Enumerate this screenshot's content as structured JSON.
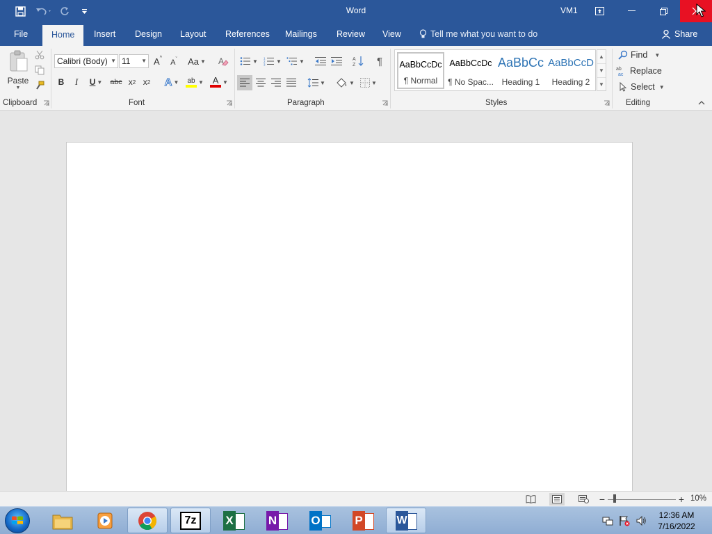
{
  "window": {
    "title": "Word",
    "user": "VM1"
  },
  "tabs": {
    "file": "File",
    "home": "Home",
    "insert": "Insert",
    "design": "Design",
    "layout": "Layout",
    "references": "References",
    "mailings": "Mailings",
    "review": "Review",
    "view": "View",
    "tell_me": "Tell me what you want to do",
    "share": "Share"
  },
  "ribbon": {
    "clipboard": {
      "paste_label": "Paste",
      "group_label": "Clipboard"
    },
    "font": {
      "font_name": "Calibri (Body)",
      "font_size": "11",
      "change_case": "Aa",
      "bold": "B",
      "italic": "I",
      "underline": "U",
      "strikethrough": "abc",
      "subscript": "x",
      "subscript_mark": "2",
      "superscript": "x",
      "superscript_mark": "2",
      "grow": "A",
      "shrink": "A",
      "text_effects": "A",
      "font_color": "A",
      "highlight": "ab",
      "group_label": "Font"
    },
    "paragraph": {
      "show_marks": "¶",
      "group_label": "Paragraph"
    },
    "styles": {
      "items": [
        {
          "sample": "AaBbCcDc",
          "name": "¶ Normal"
        },
        {
          "sample": "AaBbCcDc",
          "name": "¶ No Spac..."
        },
        {
          "sample": "AaBbCc",
          "name": "Heading 1"
        },
        {
          "sample": "AaBbCcD",
          "name": "Heading 2"
        }
      ],
      "group_label": "Styles"
    },
    "editing": {
      "find": "Find",
      "replace": "Replace",
      "select": "Select",
      "group_label": "Editing"
    }
  },
  "statusbar": {
    "zoom_percent": "10%",
    "zoom_level": 0.1
  },
  "taskbar": {
    "apps": [
      {
        "name": "file-explorer-app",
        "active": false
      },
      {
        "name": "media-player-app",
        "active": false
      },
      {
        "name": "chrome-app",
        "active": true
      },
      {
        "name": "7zip-app",
        "active": true
      },
      {
        "name": "excel-app",
        "active": false
      },
      {
        "name": "onenote-app",
        "active": false
      },
      {
        "name": "outlook-app",
        "active": false
      },
      {
        "name": "powerpoint-app",
        "active": false
      },
      {
        "name": "word-app",
        "active": true
      }
    ],
    "seven_zip_label": "7z",
    "excel_letter": "X",
    "onenote_letter": "N",
    "outlook_letter": "O",
    "powerpoint_letter": "P",
    "word_letter": "W",
    "clock_time": "12:36 AM",
    "clock_date": "7/16/2022"
  },
  "colors": {
    "word_blue": "#2b579a",
    "close_red": "#e81123",
    "ribbon_bg": "#f3f3f3",
    "canvas_bg": "#e6e6e6"
  }
}
